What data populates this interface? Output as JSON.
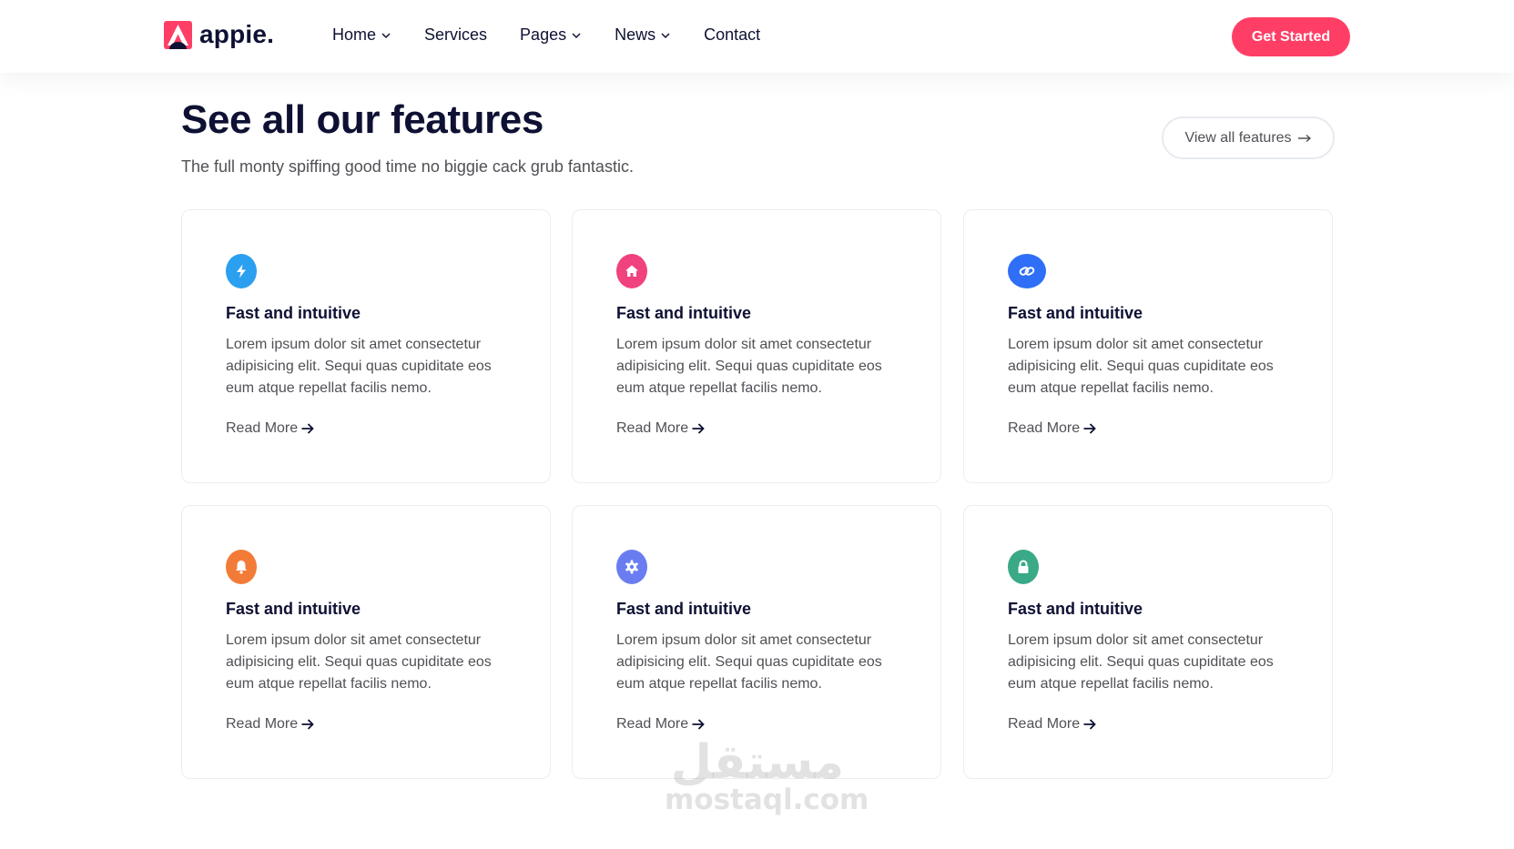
{
  "header": {
    "logo_text": "appie.",
    "nav": [
      {
        "label": "Home",
        "has_dropdown": true
      },
      {
        "label": "Services",
        "has_dropdown": false
      },
      {
        "label": "Pages",
        "has_dropdown": true
      },
      {
        "label": "News",
        "has_dropdown": true
      },
      {
        "label": "Contact",
        "has_dropdown": false
      }
    ],
    "cta_label": "Get Started"
  },
  "section": {
    "title": "See all our features",
    "subtitle": "The full monty spiffing good time no biggie cack grub fantastic.",
    "view_all_label": "View all features"
  },
  "features": [
    {
      "icon": "bolt-icon",
      "icon_color": "#2b9ff0",
      "title": "Fast and intuitive",
      "text": "Lorem ipsum dolor sit amet consectetur adipisicing elit. Sequi quas cupiditate eos eum atque repellat facilis nemo.",
      "link": "Read More"
    },
    {
      "icon": "home-icon",
      "icon_color": "#f0427f",
      "title": "Fast and intuitive",
      "text": "Lorem ipsum dolor sit amet consectetur adipisicing elit. Sequi quas cupiditate eos eum atque repellat facilis nemo.",
      "link": "Read More"
    },
    {
      "icon": "link-icon",
      "icon_color": "#2f6ef6",
      "title": "Fast and intuitive",
      "text": "Lorem ipsum dolor sit amet consectetur adipisicing elit. Sequi quas cupiditate eos eum atque repellat facilis nemo.",
      "link": "Read More"
    },
    {
      "icon": "bell-icon",
      "icon_color": "#f37b38",
      "title": "Fast and intuitive",
      "text": "Lorem ipsum dolor sit amet consectetur adipisicing elit. Sequi quas cupiditate eos eum atque repellat facilis nemo.",
      "link": "Read More"
    },
    {
      "icon": "gear-icon",
      "icon_color": "#6a7df0",
      "title": "Fast and intuitive",
      "text": "Lorem ipsum dolor sit amet consectetur adipisicing elit. Sequi quas cupiditate eos eum atque repellat facilis nemo.",
      "link": "Read More"
    },
    {
      "icon": "lock-icon",
      "icon_color": "#3aa988",
      "title": "Fast and intuitive",
      "text": "Lorem ipsum dolor sit amet consectetur adipisicing elit. Sequi quas cupiditate eos eum atque repellat facilis nemo.",
      "link": "Read More"
    }
  ],
  "colors": {
    "brand": "#ff3e66",
    "heading": "#0e1133",
    "body": "#505056"
  },
  "watermark": {
    "arabic": "مستقل",
    "latin": "mostaql.com"
  }
}
